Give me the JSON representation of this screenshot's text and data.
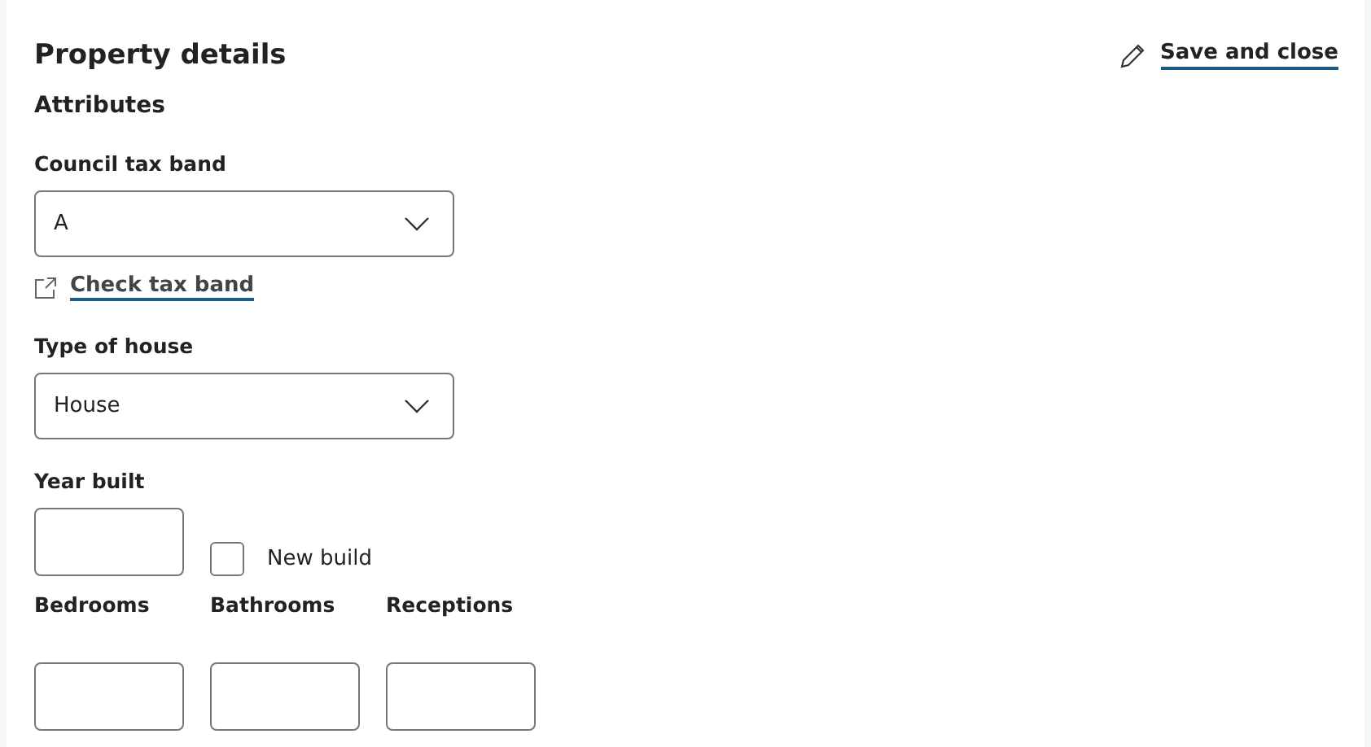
{
  "title": "Property details",
  "save_link": "Save and close",
  "section": "Attributes",
  "council_tax": {
    "label": "Council tax band",
    "value": "A",
    "link": "Check tax band"
  },
  "house_type": {
    "label": "Type of house",
    "value": "House"
  },
  "year_built": {
    "label": "Year built"
  },
  "new_build": {
    "label": "New build",
    "checked": false
  },
  "rooms": [
    {
      "label": "Bedrooms"
    },
    {
      "label": "Bathrooms"
    },
    {
      "label": "Receptions"
    }
  ]
}
